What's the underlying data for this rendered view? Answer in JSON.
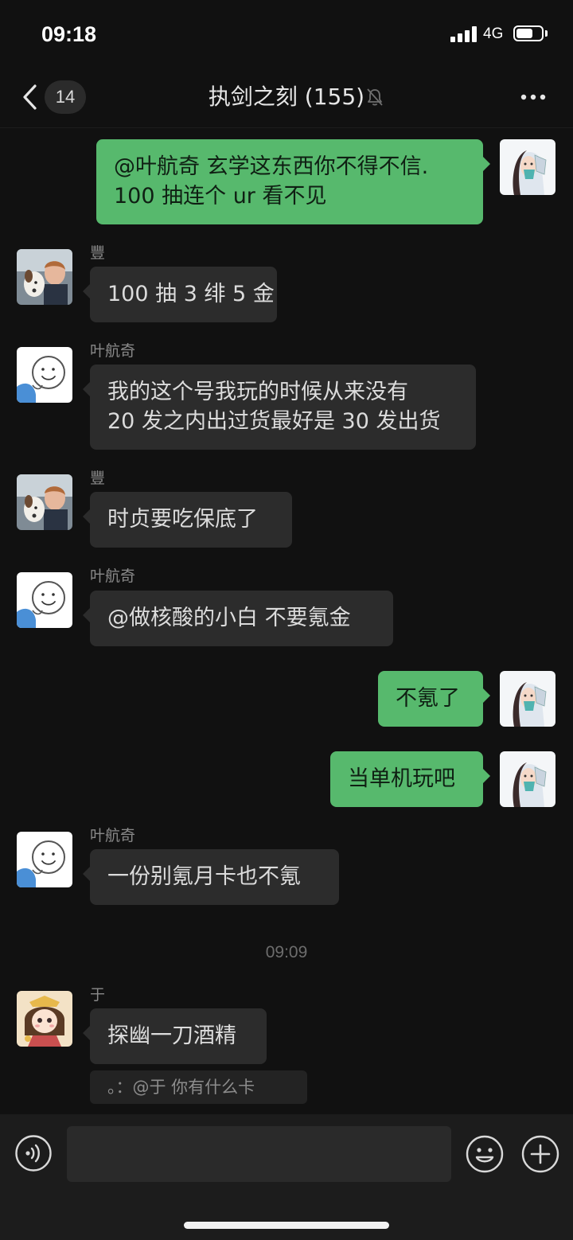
{
  "status_bar": {
    "time": "09:18",
    "network": "4G",
    "battery_level": 0.6
  },
  "nav": {
    "back_count": "14",
    "title": "执剑之刻 (155)",
    "muted": true,
    "more_icon": "more-horizontal-icon"
  },
  "messages": [
    {
      "direction": "out",
      "sender": "",
      "avatar": "avatar-girl-mask",
      "lines": [
        "@叶航奇 玄学这东西你不得不信.",
        "100 抽连个 ur 看不见"
      ]
    },
    {
      "direction": "in",
      "sender": "豐",
      "avatar": "avatar-boy-dog",
      "lines": [
        "100 抽 3 绯 5 金"
      ]
    },
    {
      "direction": "in",
      "sender": "叶航奇",
      "avatar": "avatar-smiley",
      "lines": [
        "我的这个号我玩的时候从来没有",
        "20 发之内出过货最好是 30 发出货"
      ]
    },
    {
      "direction": "in",
      "sender": "豐",
      "avatar": "avatar-boy-dog",
      "lines": [
        "时贞要吃保底了"
      ]
    },
    {
      "direction": "in",
      "sender": "叶航奇",
      "avatar": "avatar-smiley",
      "lines": [
        "@做核酸的小白 不要氪金"
      ]
    },
    {
      "direction": "out",
      "sender": "",
      "avatar": "avatar-girl-mask",
      "lines": [
        "不氪了"
      ]
    },
    {
      "direction": "out",
      "sender": "",
      "avatar": "avatar-girl-mask",
      "lines": [
        "当单机玩吧"
      ]
    },
    {
      "direction": "in",
      "sender": "叶航奇",
      "avatar": "avatar-smiley",
      "lines": [
        "一份别氪月卡也不氪"
      ]
    },
    {
      "direction": "in",
      "sender": "于",
      "avatar": "avatar-cartoon-girl",
      "lines": [
        "探幽一刀酒精"
      ]
    }
  ],
  "time_divider": "09:09",
  "quote": "。：@于 你有什么卡",
  "input": {
    "value": "",
    "voice_icon": "voice-icon",
    "emoji_icon": "emoji-icon",
    "plus_icon": "plus-icon"
  },
  "colors": {
    "background": "#111111",
    "incoming_bubble": "#2c2c2c",
    "outgoing_bubble": "#57b96d"
  }
}
